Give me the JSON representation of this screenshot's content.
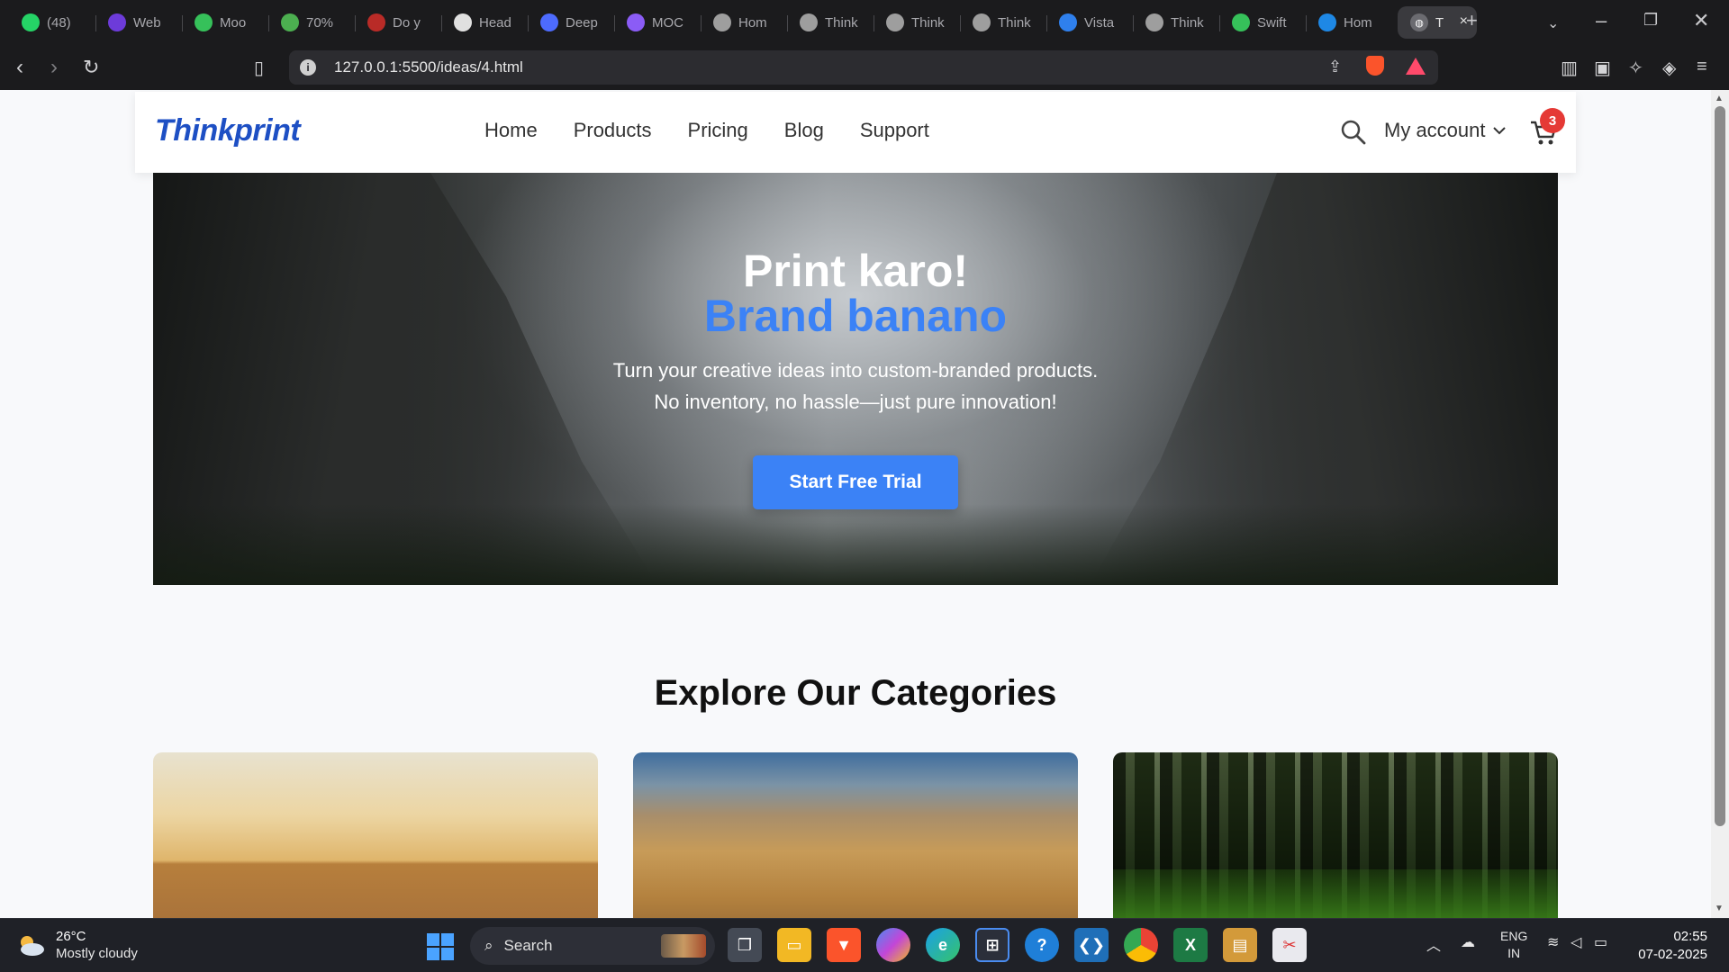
{
  "browser": {
    "tabs": [
      {
        "label": "(48)",
        "icon": "whatsapp-icon",
        "color": "#25d366"
      },
      {
        "label": "Web",
        "icon": "webflow-icon",
        "color": "#6d3bd9"
      },
      {
        "label": "Moo",
        "icon": "moo-icon",
        "color": "#36c15a"
      },
      {
        "label": "70%",
        "icon": "c-icon",
        "color": "#4caf50"
      },
      {
        "label": "Do y",
        "icon": "quora-icon",
        "color": "#b92b27"
      },
      {
        "label": "Head",
        "icon": "openai-icon",
        "color": "#e0e0e0"
      },
      {
        "label": "Deep",
        "icon": "deepseek-icon",
        "color": "#4d6bfe"
      },
      {
        "label": "MOC",
        "icon": "perplexity-icon",
        "color": "#8b5cf6"
      },
      {
        "label": "Hom",
        "icon": "globe-icon",
        "color": "#9e9e9e"
      },
      {
        "label": "Think",
        "icon": "globe-icon",
        "color": "#9e9e9e"
      },
      {
        "label": "Think",
        "icon": "globe-icon",
        "color": "#9e9e9e"
      },
      {
        "label": "Think",
        "icon": "globe-icon",
        "color": "#9e9e9e"
      },
      {
        "label": "Vista",
        "icon": "vista-icon",
        "color": "#2f80ed"
      },
      {
        "label": "Think",
        "icon": "globe-icon",
        "color": "#9e9e9e"
      },
      {
        "label": "Swift",
        "icon": "swift-icon",
        "color": "#36c15a"
      },
      {
        "label": "Hom",
        "icon": "home-icon",
        "color": "#1e88e5"
      }
    ],
    "active_tab": {
      "label": "T",
      "close": "×"
    },
    "new_tab": "+",
    "url": "127.0.0.1:5500/ideas/4.html"
  },
  "site": {
    "logo": "Thinkprint",
    "nav": [
      "Home",
      "Products",
      "Pricing",
      "Blog",
      "Support"
    ],
    "account_label": "My account",
    "cart_count": "3"
  },
  "hero": {
    "title_line1": "Print karo!",
    "title_line2": "Brand banano",
    "subtitle_line1": "Turn your creative ideas into custom-branded products.",
    "subtitle_line2": "No inventory, no hassle—just pure innovation!",
    "cta_label": "Start Free Trial"
  },
  "categories": {
    "title": "Explore Our Categories"
  },
  "taskbar": {
    "temperature": "26°C",
    "condition": "Mostly cloudy",
    "search_label": "Search",
    "language": "ENG",
    "region": "IN",
    "time": "02:55",
    "date": "07-02-2025"
  },
  "colors": {
    "brand": "#1d4fc4",
    "accent": "#3b82f6",
    "badge": "#e53935"
  }
}
